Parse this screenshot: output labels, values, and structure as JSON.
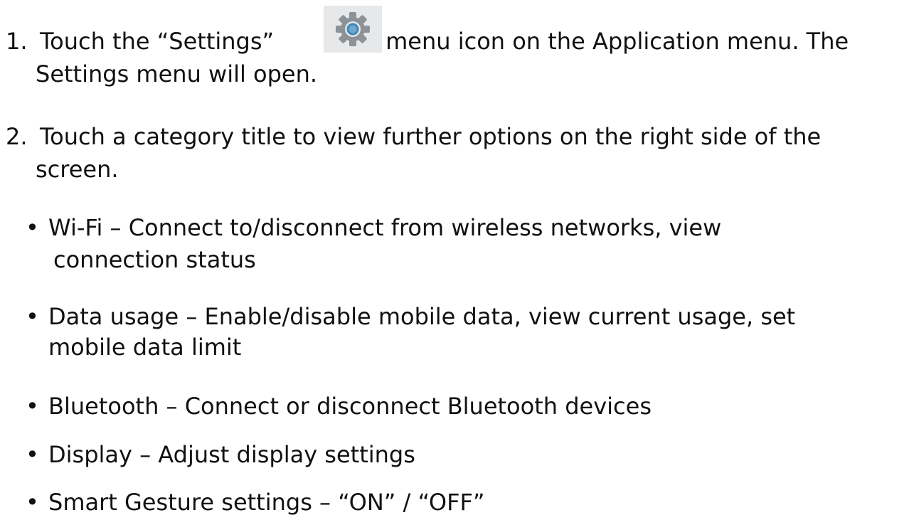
{
  "steps": [
    {
      "number": "1.",
      "before_icon": "Touch the “Settings”",
      "icon": "gear-icon",
      "after_icon": "menu icon on the Application menu. The",
      "continuation": "Settings menu will open."
    },
    {
      "number": "2.",
      "text": "Touch a category title to view further options on the right side of the",
      "continuation": "screen."
    }
  ],
  "bullets": [
    {
      "symbol": "•",
      "text": "Wi-Fi – Connect to/disconnect from wireless networks, view",
      "continuation": "connection status"
    },
    {
      "symbol": "•",
      "text": "Data usage – Enable/disable mobile data, view current usage, set",
      "continuation": "mobile data limit"
    },
    {
      "symbol": "•",
      "text": "Bluetooth – Connect or disconnect Bluetooth devices"
    },
    {
      "symbol": "•",
      "text": "Display – Adjust display settings"
    },
    {
      "symbol": "•",
      "text": "Smart Gesture settings – “ON” / “OFF”"
    }
  ],
  "colors": {
    "text": "#111111",
    "icon_bg": "#e6e8e9",
    "gear": "#8c9296",
    "gear_center": "#3f87b8"
  }
}
